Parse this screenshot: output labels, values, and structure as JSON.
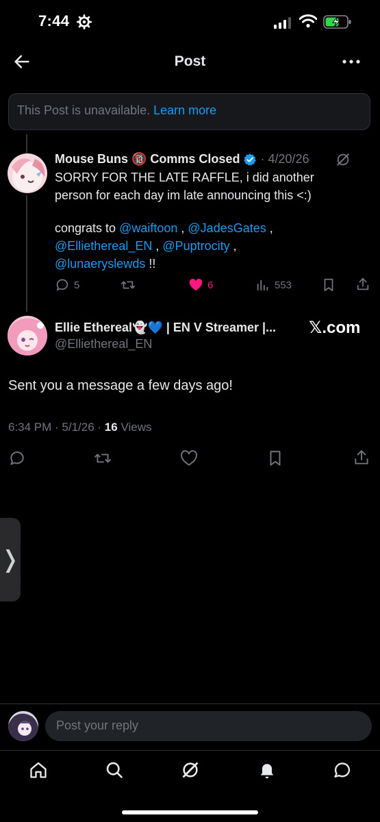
{
  "status_bar": {
    "time": "7:44"
  },
  "header": {
    "title": "Post"
  },
  "unavailable": {
    "text": "This Post is unavailable.",
    "link": "Learn more"
  },
  "parent_post": {
    "author_name": "Mouse Buns 🔞 Comms Closed",
    "date": "· 4/20/26",
    "line1": "SORRY FOR THE LATE RAFFLE, i did another",
    "line2": "person for each day im late announcing this <:)",
    "congrats": "congrats to ",
    "mentions": [
      "@waiftoon",
      "@JadesGates",
      "@Elliethereal_EN",
      "@Puptrocity",
      "@lunaeryslewds"
    ],
    "sep": " , ",
    "end": " !!",
    "replies": "5",
    "likes": "6",
    "views": "553"
  },
  "main_post": {
    "author_name": "Ellie Ethereal👻💙 | EN V Streamer |...",
    "handle": "@Elliethereal_EN",
    "source_badge": "𝕏.com",
    "text": "Sent you a message a few days ago!",
    "timestamp": "6:34 PM · 5/1/26 · ",
    "views_count": "16",
    "views_label": " Views"
  },
  "reply_bar": {
    "placeholder": "Post your reply"
  },
  "side_tray": {
    "glyph": "❭"
  },
  "colors": {
    "accent": "#1d9bf0",
    "like": "#f91880",
    "background": "#000000",
    "muted": "#71767b"
  }
}
